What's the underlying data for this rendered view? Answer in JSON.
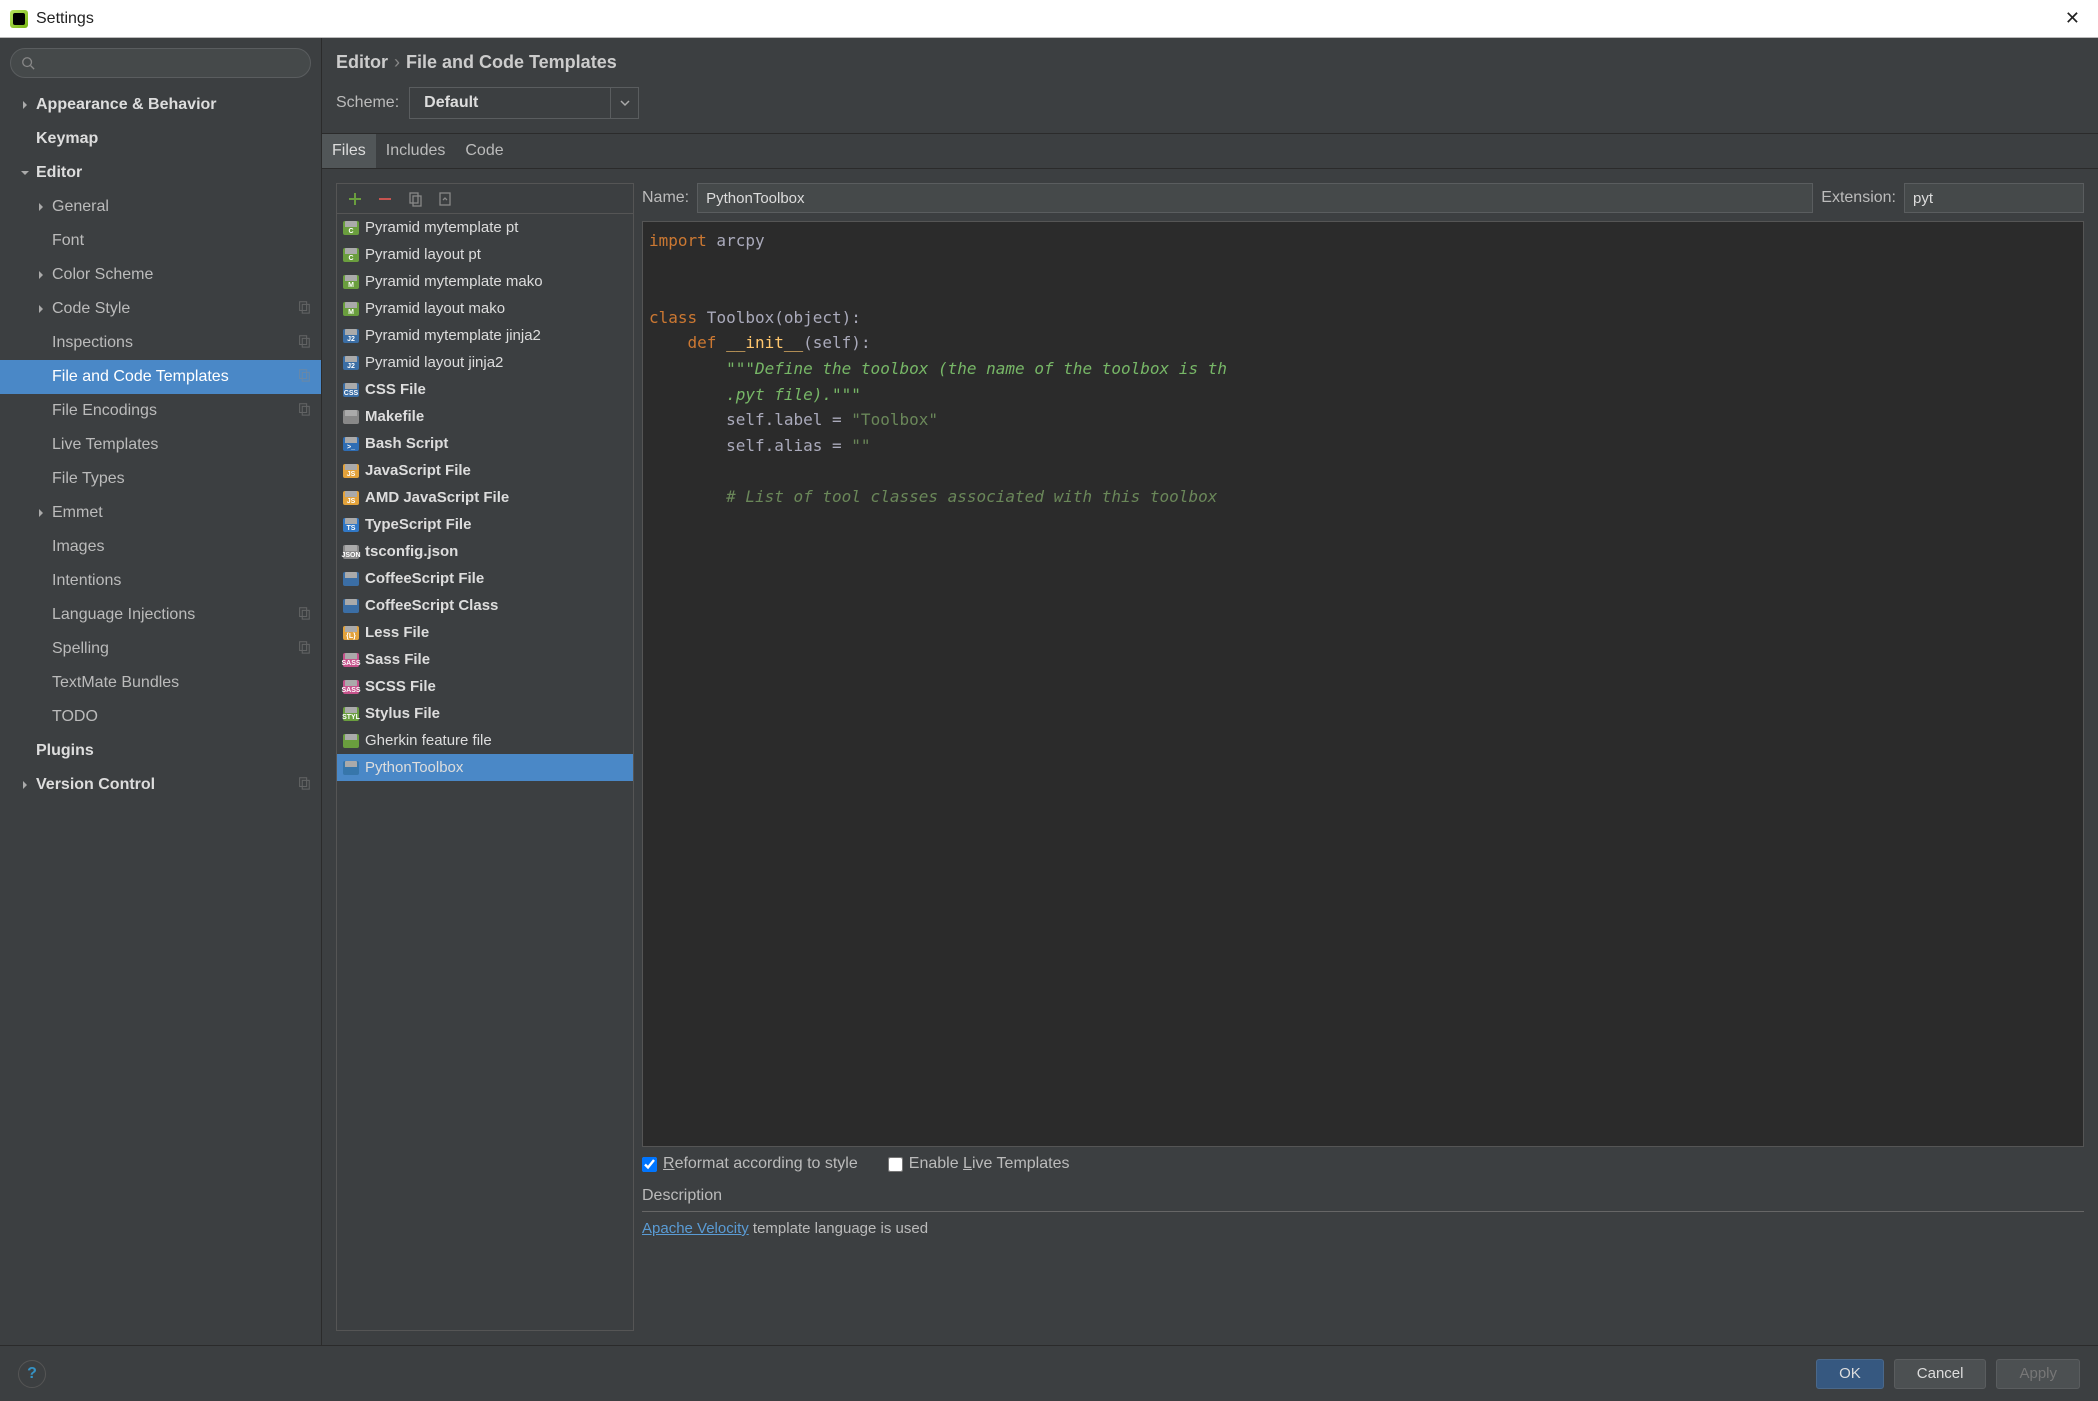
{
  "window": {
    "title": "Settings"
  },
  "sidebar": {
    "items": [
      {
        "label": "Appearance & Behavior",
        "bold": true,
        "level": 0,
        "expand": "right"
      },
      {
        "label": "Keymap",
        "bold": true,
        "level": 0
      },
      {
        "label": "Editor",
        "bold": true,
        "level": 0,
        "expand": "down"
      },
      {
        "label": "General",
        "level": 1,
        "expand": "right"
      },
      {
        "label": "Font",
        "level": 1
      },
      {
        "label": "Color Scheme",
        "level": 1,
        "expand": "right"
      },
      {
        "label": "Code Style",
        "level": 1,
        "expand": "right",
        "copy": true
      },
      {
        "label": "Inspections",
        "level": 1,
        "copy": true
      },
      {
        "label": "File and Code Templates",
        "level": 1,
        "selected": true,
        "copy": true
      },
      {
        "label": "File Encodings",
        "level": 1,
        "copy": true
      },
      {
        "label": "Live Templates",
        "level": 1
      },
      {
        "label": "File Types",
        "level": 1
      },
      {
        "label": "Emmet",
        "level": 1,
        "expand": "right"
      },
      {
        "label": "Images",
        "level": 1
      },
      {
        "label": "Intentions",
        "level": 1
      },
      {
        "label": "Language Injections",
        "level": 1,
        "copy": true
      },
      {
        "label": "Spelling",
        "level": 1,
        "copy": true
      },
      {
        "label": "TextMate Bundles",
        "level": 1
      },
      {
        "label": "TODO",
        "level": 1
      },
      {
        "label": "Plugins",
        "bold": true,
        "level": 0
      },
      {
        "label": "Version Control",
        "bold": true,
        "level": 0,
        "expand": "right",
        "copy": true
      }
    ]
  },
  "breadcrumb": {
    "root": "Editor",
    "leaf": "File and Code Templates"
  },
  "scheme": {
    "label": "Scheme:",
    "value": "Default"
  },
  "tabs": [
    {
      "label": "Files",
      "active": true
    },
    {
      "label": "Includes"
    },
    {
      "label": "Code"
    }
  ],
  "templates": [
    {
      "label": "Pyramid mytemplate pt",
      "color": "#6a9e3e",
      "tag": "C"
    },
    {
      "label": "Pyramid layout pt",
      "color": "#6a9e3e",
      "tag": "C"
    },
    {
      "label": "Pyramid mytemplate mako",
      "color": "#6a9e3e",
      "tag": "M"
    },
    {
      "label": "Pyramid layout mako",
      "color": "#6a9e3e",
      "tag": "M"
    },
    {
      "label": "Pyramid mytemplate jinja2",
      "color": "#3b6ea5",
      "tag": "J2"
    },
    {
      "label": "Pyramid layout jinja2",
      "color": "#3b6ea5",
      "tag": "J2"
    },
    {
      "label": "CSS File",
      "bold": true,
      "color": "#3b6ea5",
      "tag": "CSS"
    },
    {
      "label": "Makefile",
      "bold": true,
      "color": "#888",
      "tag": ""
    },
    {
      "label": "Bash Script",
      "bold": true,
      "color": "#2e6db4",
      "tag": ">_"
    },
    {
      "label": "JavaScript File",
      "bold": true,
      "color": "#e2a23b",
      "tag": "JS"
    },
    {
      "label": "AMD JavaScript File",
      "bold": true,
      "color": "#e2a23b",
      "tag": "JS"
    },
    {
      "label": "TypeScript File",
      "bold": true,
      "color": "#3178c6",
      "tag": "TS"
    },
    {
      "label": "tsconfig.json",
      "bold": true,
      "color": "#888",
      "tag": "JSON"
    },
    {
      "label": "CoffeeScript File",
      "bold": true,
      "color": "#3b6ea5",
      "tag": ""
    },
    {
      "label": "CoffeeScript Class",
      "bold": true,
      "color": "#3b6ea5",
      "tag": ""
    },
    {
      "label": "Less File",
      "bold": true,
      "color": "#e2a23b",
      "tag": "{L}"
    },
    {
      "label": "Sass File",
      "bold": true,
      "color": "#c6538c",
      "tag": "SASS"
    },
    {
      "label": "SCSS File",
      "bold": true,
      "color": "#c6538c",
      "tag": "SASS"
    },
    {
      "label": "Stylus File",
      "bold": true,
      "color": "#6a9e3e",
      "tag": "STYL"
    },
    {
      "label": "Gherkin feature file",
      "color": "#6a9e3e",
      "tag": ""
    },
    {
      "label": "PythonToolbox",
      "selected": true,
      "color": "#3776ab",
      "tag": ""
    }
  ],
  "editor": {
    "name_label": "Name:",
    "name_value": "PythonToolbox",
    "ext_label": "Extension:",
    "ext_value": "pyt",
    "reformat_label_pre": "R",
    "reformat_label": "eformat according to style",
    "live_label_pre": "Enable ",
    "live_label_u": "L",
    "live_label_post": "ive Templates",
    "reformat_checked": true,
    "live_checked": false,
    "desc_label": "Description",
    "desc_link": "Apache Velocity",
    "desc_text": " template language is used"
  },
  "footer": {
    "ok": "OK",
    "cancel": "Cancel",
    "apply": "Apply"
  }
}
